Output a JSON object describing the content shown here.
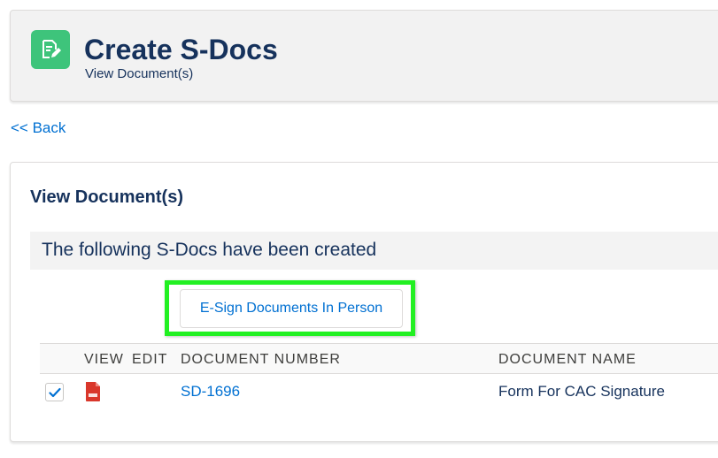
{
  "header": {
    "title": "Create S-Docs",
    "subtitle": "View Document(s)",
    "icon": "document-edit-icon",
    "icon_color": "#3ec47b"
  },
  "back_link": {
    "label": "<< Back"
  },
  "main": {
    "heading": "View Document(s)",
    "notice": "The following S-Docs have been created",
    "esign_button_label": "E-Sign Documents In Person",
    "highlight_color": "#22f022"
  },
  "table": {
    "columns": [
      "VIEW",
      "EDIT",
      "DOCUMENT NUMBER",
      "DOCUMENT NAME"
    ],
    "rows": [
      {
        "checked": true,
        "view_icon": "pdf-icon",
        "document_number": "SD-1696",
        "document_name": "Form For CAC Signature"
      }
    ]
  },
  "colors": {
    "link": "#0070d2",
    "text": "#16325c",
    "pdf": "#d9372b"
  }
}
